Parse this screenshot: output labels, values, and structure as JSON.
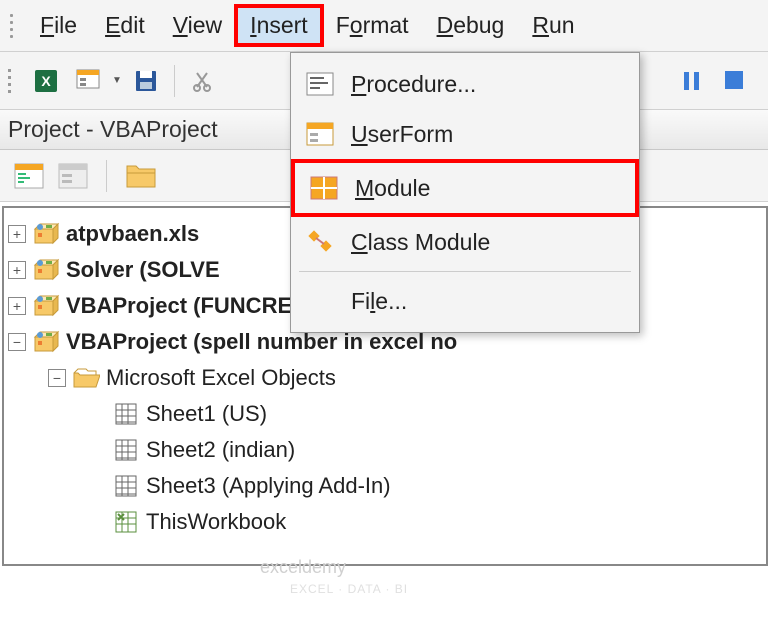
{
  "menubar": {
    "items": [
      {
        "label": "File",
        "accel": 0
      },
      {
        "label": "Edit",
        "accel": 0
      },
      {
        "label": "View",
        "accel": 0
      },
      {
        "label": "Insert",
        "accel": 0,
        "active": true,
        "highlight": true
      },
      {
        "label": "Format",
        "accel": 1
      },
      {
        "label": "Debug",
        "accel": 0
      },
      {
        "label": "Run",
        "accel": 0
      }
    ]
  },
  "dropdown": {
    "items": [
      {
        "icon": "procedure-icon",
        "label": "Procedure...",
        "accel": 0
      },
      {
        "icon": "userform-icon",
        "label": "UserForm",
        "accel": 0
      },
      {
        "icon": "module-icon",
        "label": "Module",
        "accel": 0,
        "highlight": true
      },
      {
        "icon": "classmodule-icon",
        "label": "Class Module",
        "accel": 0
      },
      {
        "sep": true
      },
      {
        "icon": "",
        "label": "File...",
        "accel": 2
      }
    ]
  },
  "panel": {
    "title": "Project - VBAProject"
  },
  "tree": {
    "nodes": [
      {
        "exp": "+",
        "icon": "vba-project-icon",
        "label": "atpvbaen.xls",
        "bold": true,
        "indent": 0
      },
      {
        "exp": "+",
        "icon": "vba-project-icon",
        "label": "Solver (SOLVE",
        "bold": true,
        "indent": 0
      },
      {
        "exp": "+",
        "icon": "vba-project-icon",
        "label": "VBAProject (FUNCRES.XLAM)",
        "bold": true,
        "indent": 0
      },
      {
        "exp": "-",
        "icon": "vba-project-icon",
        "label": "VBAProject (spell number in excel no",
        "bold": true,
        "indent": 0
      },
      {
        "exp": "-",
        "icon": "folder-open-icon",
        "label": "Microsoft Excel Objects",
        "bold": false,
        "indent": 1
      },
      {
        "exp": "",
        "icon": "sheet-icon",
        "label": "Sheet1 (US)",
        "bold": false,
        "indent": 2
      },
      {
        "exp": "",
        "icon": "sheet-icon",
        "label": "Sheet2 (indian)",
        "bold": false,
        "indent": 2
      },
      {
        "exp": "",
        "icon": "sheet-icon",
        "label": "Sheet3 (Applying Add-In)",
        "bold": false,
        "indent": 2
      },
      {
        "exp": "",
        "icon": "workbook-icon",
        "label": "ThisWorkbook",
        "bold": false,
        "indent": 2
      }
    ]
  },
  "watermark": {
    "brand": "exceldemy",
    "tagline": "EXCEL · DATA · BI"
  }
}
